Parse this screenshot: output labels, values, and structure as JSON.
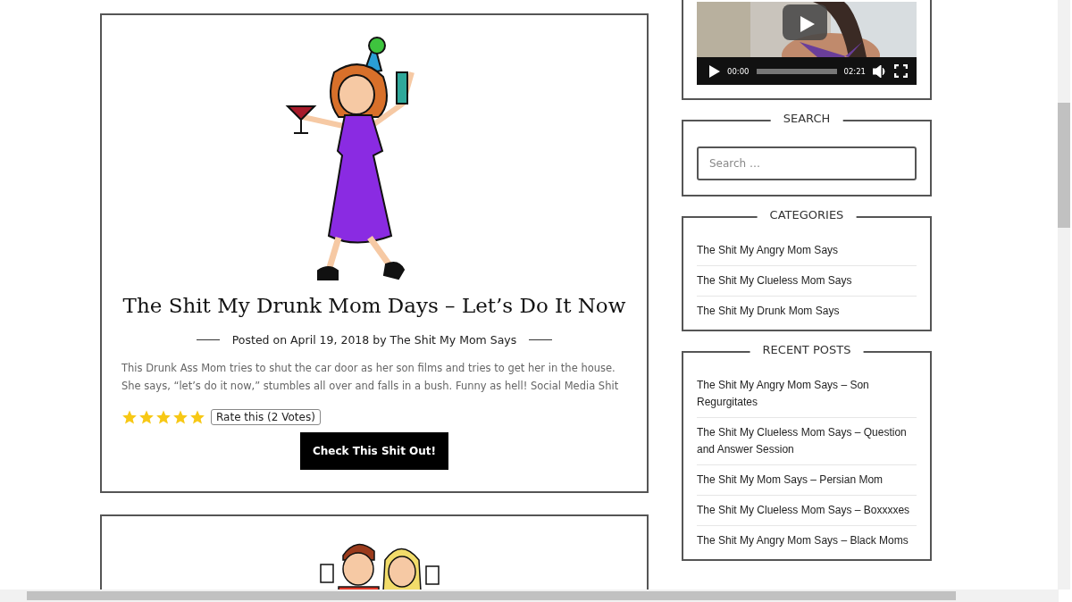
{
  "posts": [
    {
      "kind": "full",
      "title": "The Shit My Drunk Mom Days – Let’s Do It Now",
      "meta": "Posted on April 19, 2018 by The Shit My Mom Says",
      "excerpt": "This Drunk Ass Mom tries to shut the car door as her son films and tries to get her in the house. She says, “let’s do it now,” stumbles all over and falls in a bush. Funny as hell! Social Media Shit",
      "stars": 5,
      "rating_label": "Rate this (2 Votes)",
      "button": "Check This Shit Out!"
    },
    {
      "kind": "cut"
    }
  ],
  "video": {
    "current_time": "00:00",
    "duration": "02:21"
  },
  "search": {
    "title": "SEARCH",
    "placeholder": "Search …"
  },
  "categories": {
    "title": "CATEGORIES",
    "items": [
      "The Shit My Angry Mom Says",
      "The Shit My Clueless Mom Says",
      "The Shit My Drunk Mom Says"
    ]
  },
  "recent_posts": {
    "title": "RECENT POSTS",
    "items": [
      "The Shit My Angry Mom Says – Son Regurgitates",
      "The Shit My Clueless Mom Says – Question and Answer Session",
      "The Shit My Mom Says – Persian Mom",
      "The Shit My Clueless Mom Says – Boxxxxes",
      "The Shit My Angry Mom Says – Black Moms"
    ]
  }
}
